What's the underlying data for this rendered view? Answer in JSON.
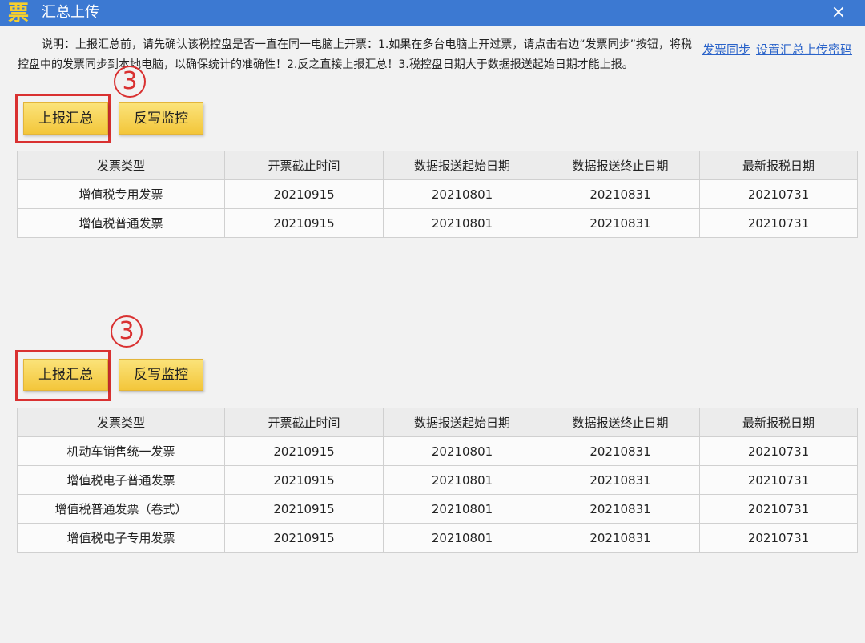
{
  "window": {
    "title": "汇总上传",
    "app_icon_glyph": "票",
    "close_glyph": "×"
  },
  "notice": "说明：上报汇总前，请先确认该税控盘是否一直在同一电脑上开票：1.如果在多台电脑上开过票，请点击右边“发票同步”按钮，将税控盘中的发票同步到本地电脑，以确保统计的准确性！2.反之直接上报汇总！3.税控盘日期大于数据报送起始日期才能上报。",
  "links": {
    "sync": "发票同步",
    "set_password": "设置汇总上传密码"
  },
  "buttons": {
    "report_summary": "上报汇总",
    "write_back_monitor": "反写监控"
  },
  "annotation": {
    "step_number": "3",
    "color": "#d93131"
  },
  "columns": [
    "发票类型",
    "开票截止时间",
    "数据报送起始日期",
    "数据报送终止日期",
    "最新报税日期"
  ],
  "table1": {
    "rows": [
      [
        "增值税专用发票",
        "20210915",
        "20210801",
        "20210831",
        "20210731"
      ],
      [
        "增值税普通发票",
        "20210915",
        "20210801",
        "20210831",
        "20210731"
      ]
    ]
  },
  "table2": {
    "rows": [
      [
        "机动车销售统一发票",
        "20210915",
        "20210801",
        "20210831",
        "20210731"
      ],
      [
        "增值税电子普通发票",
        "20210915",
        "20210801",
        "20210831",
        "20210731"
      ],
      [
        "增值税普通发票（卷式）",
        "20210915",
        "20210801",
        "20210831",
        "20210731"
      ],
      [
        "增值税电子专用发票",
        "20210915",
        "20210801",
        "20210831",
        "20210731"
      ]
    ]
  },
  "colors": {
    "titlebar": "#3c79d2",
    "button": "#f3c63a",
    "link": "#2a63c9"
  }
}
